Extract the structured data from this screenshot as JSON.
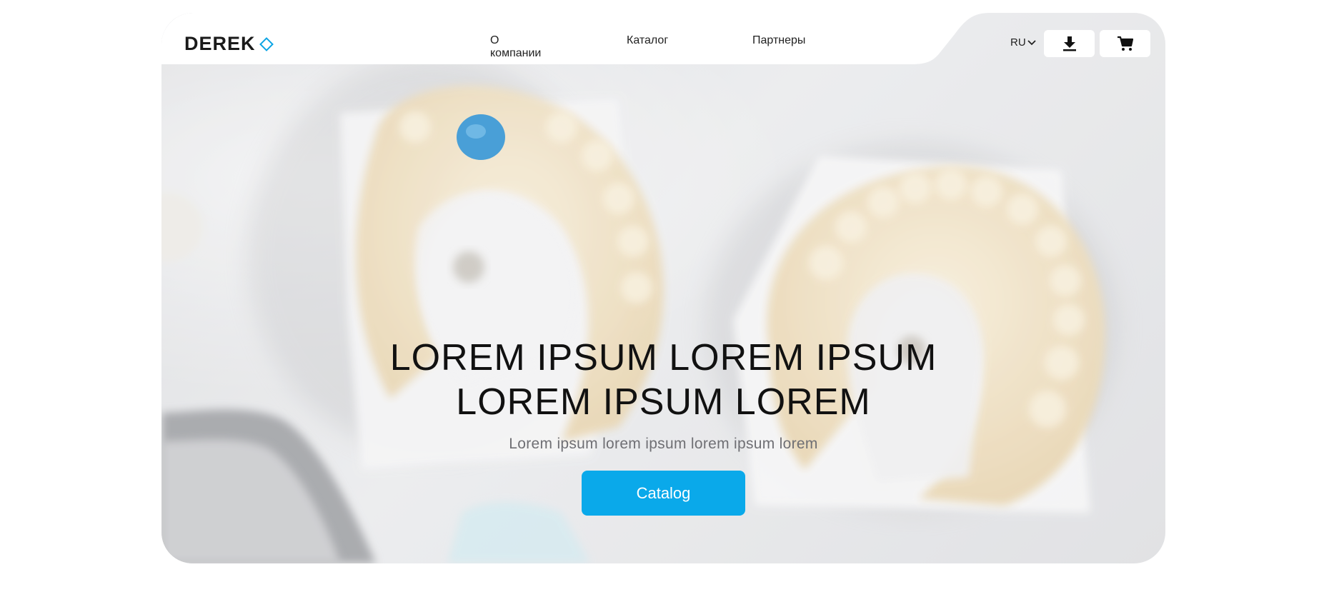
{
  "header": {
    "logo_text": "DEREK",
    "nav": [
      "О компании",
      "Каталог",
      "Партнеры"
    ],
    "language": "RU",
    "download_icon": "download-icon",
    "cart_icon": "cart-icon"
  },
  "hero": {
    "title_line1": "LOREM IPSUM LOREM IPSUM",
    "title_line2": "LOREM IPSUM LOREM",
    "subtitle": "Lorem ipsum lorem ipsum lorem ipsum lorem",
    "cta_label": "Catalog"
  },
  "colors": {
    "accent": "#0aa9ea",
    "text": "#111111",
    "subtitle": "#6f6f74"
  }
}
